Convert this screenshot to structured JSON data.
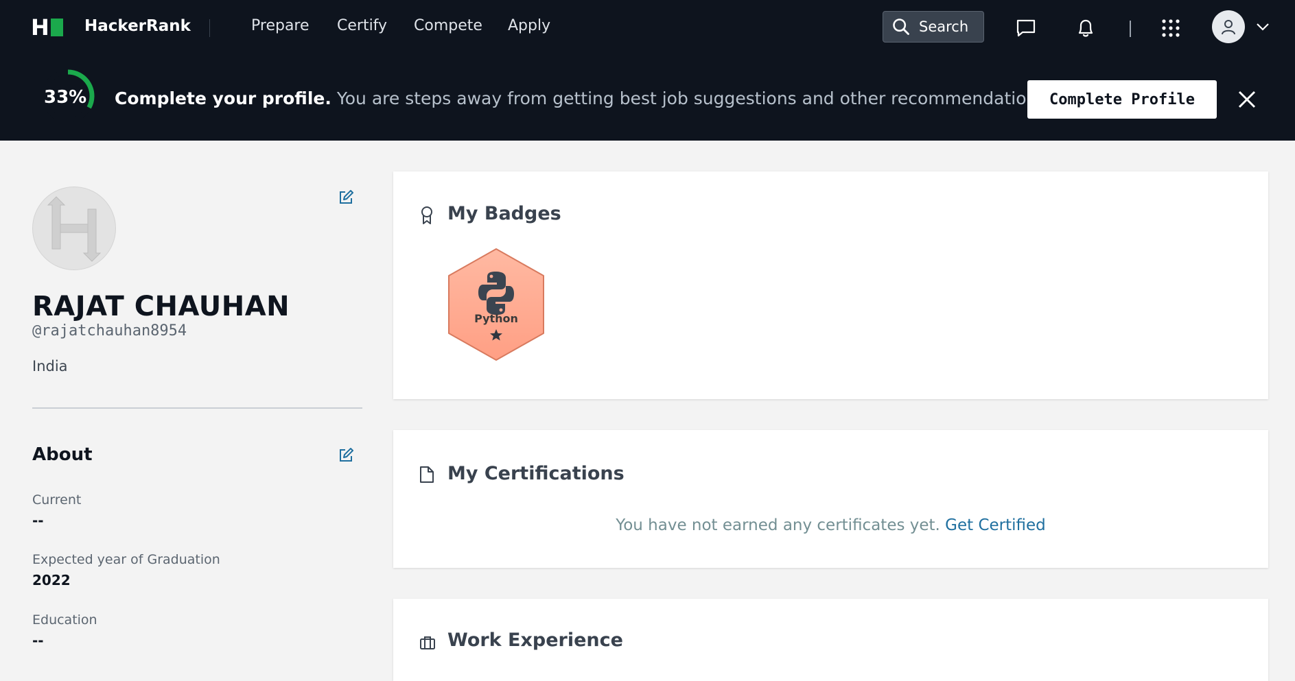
{
  "nav": {
    "brand": "HackerRank",
    "links": [
      "Prepare",
      "Certify",
      "Compete",
      "Apply"
    ],
    "search_label": "Search"
  },
  "banner": {
    "percent_text": "33%",
    "completion_fraction": 0.33,
    "title": "Complete your profile.",
    "subtitle": "You are steps away from getting best job suggestions and other recommendations.",
    "button_label": "Complete Profile"
  },
  "profile": {
    "name": "RAJAT CHAUHAN",
    "handle": "@rajatchauhan8954",
    "country": "India"
  },
  "about": {
    "heading": "About",
    "fields": [
      {
        "label": "Current",
        "value": "--"
      },
      {
        "label": "Expected year of Graduation",
        "value": "2022"
      },
      {
        "label": "Education",
        "value": "--"
      }
    ]
  },
  "badges": {
    "title": "My Badges",
    "items": [
      {
        "name": "Python",
        "stars": 1,
        "color": "#ffad95"
      }
    ]
  },
  "certifications": {
    "title": "My Certifications",
    "empty_message": "You have not earned any certificates yet.",
    "link_label": "Get Certified"
  },
  "work": {
    "title": "Work Experience"
  },
  "colors": {
    "nav_bg": "#0e141e",
    "accent_green": "#1ba94c",
    "link_blue": "#1f6f9f",
    "page_bg": "#f3f3f3"
  }
}
